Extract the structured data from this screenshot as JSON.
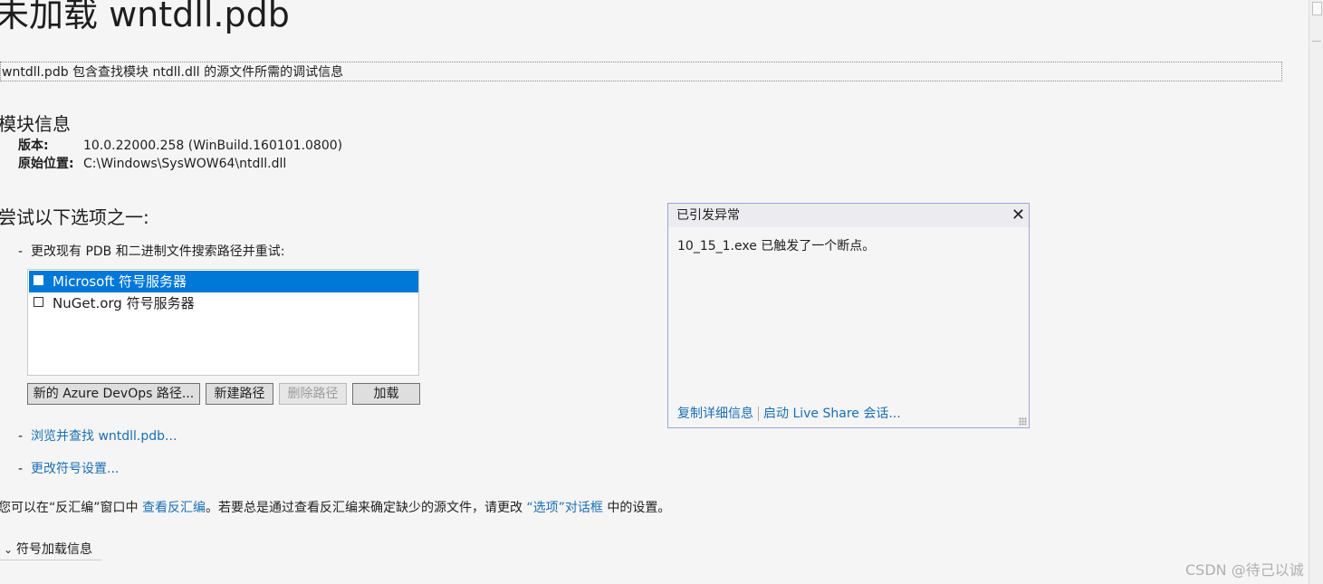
{
  "page": {
    "title": "未加载 wntdll.pdb",
    "description": "wntdll.pdb 包含查找模块 ntdll.dll 的源文件所需的调试信息"
  },
  "module_info": {
    "heading": "模块信息",
    "version_label": "版本:",
    "version_value": "10.0.22000.258 (WinBuild.160101.0800)",
    "location_label": "原始位置:",
    "location_value": "C:\\Windows\\SysWOW64\\ntdll.dll"
  },
  "options": {
    "heading": "尝试以下选项之一:",
    "dash": "-",
    "change_paths_text": "更改现有 PDB 和二进制文件搜索路径并重试:",
    "symbol_servers": [
      {
        "label": "Microsoft 符号服务器",
        "selected": true,
        "checked": false
      },
      {
        "label": "NuGet.org 符号服务器",
        "selected": false,
        "checked": false
      }
    ],
    "buttons": {
      "azure": "新的 Azure DevOps 路径...",
      "new_path": "新建路径",
      "delete_path": "删除路径",
      "load": "加载"
    },
    "browse_link": "浏览并查找 wntdll.pdb...",
    "settings_link": "更改符号设置..."
  },
  "footnote": {
    "prefix": "您可以在“反汇编”窗口中 ",
    "disasm_link": "查看反汇编",
    "middle": "。若要总是通过查看反汇编来确定缺少的源文件，请更改 ",
    "options_link": "“选项”对话框",
    "suffix": " 中的设置。"
  },
  "symbol_load": {
    "toggle_icon": "⌄",
    "label": "符号加载信息"
  },
  "exception_popup": {
    "title": "已引发异常",
    "close_icon": "✕",
    "message": "10_15_1.exe 已触发了一个断点。",
    "copy_details_link": "复制详细信息",
    "live_share_link": "启动 Live Share 会话..."
  },
  "watermark": "CSDN @待己以诚",
  "icons": {
    "checkbox": "checkbox-icon",
    "close": "close-icon",
    "chevron": "chevron-down-icon",
    "resize_grip": "resize-grip-icon"
  },
  "colors": {
    "background": "#f5f5f5",
    "selection": "#0078d7",
    "link": "#1a6fb5",
    "popup_border": "#9aa6d6"
  }
}
